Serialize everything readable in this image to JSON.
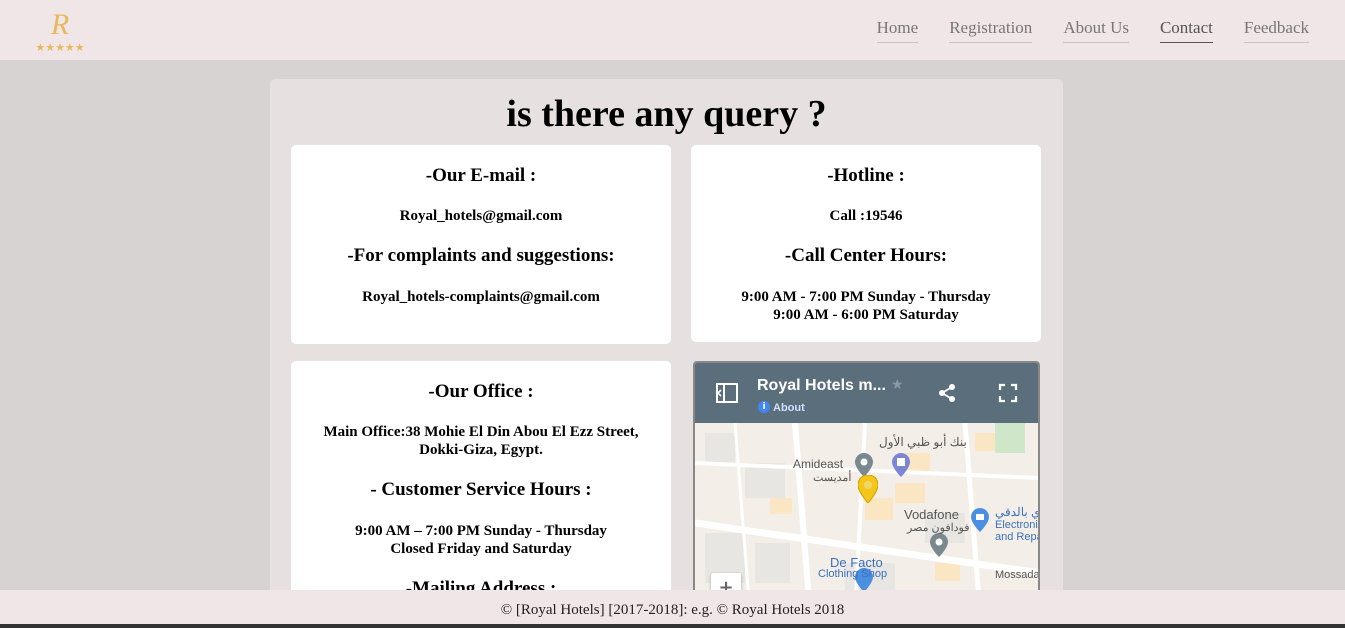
{
  "brand": {
    "logo_letter": "R",
    "logo_stars": "★★★★★"
  },
  "nav": {
    "items": [
      {
        "label": "Home"
      },
      {
        "label": "Registration"
      },
      {
        "label": "About Us"
      },
      {
        "label": "Contact"
      },
      {
        "label": "Feedback"
      }
    ],
    "active": "Contact"
  },
  "page": {
    "title": "is there any query ?"
  },
  "email_card": {
    "heading": "-Our E-mail :",
    "email": "Royal_hotels@gmail.com",
    "complaints_heading": "-For complaints and suggestions:",
    "complaints_email": "Royal_hotels-complaints@gmail.com"
  },
  "hotline_card": {
    "heading": "-Hotline :",
    "call": "Call :19546",
    "hours_heading": "-Call Center Hours:",
    "hours_line1": "9:00 AM - 7:00 PM Sunday - Thursday",
    "hours_line2": "9:00 AM - 6:00 PM Saturday"
  },
  "office_card": {
    "heading": "-Our Office :",
    "address": "Main Office:38 Mohie El Din Abou El Ezz Street, Dokki-Giza, Egypt.",
    "service_heading": "- Customer Service Hours :",
    "service_line1": "9:00 AM – 7:00 PM Sunday - Thursday",
    "service_line2": "Closed Friday and Saturday",
    "mailing_heading": "-Mailing Address :"
  },
  "map": {
    "title": "Royal Hotels m...",
    "about": "About",
    "labels": {
      "amideast": "Amideast",
      "amideast_ar": "أمديست",
      "bank_ar": "بنك أبو ظبي الأول",
      "vodafone": "Vodafone",
      "vodafone_ar": "فودافون مصر",
      "electronic1": "Electronic",
      "electronic2": "and Repai",
      "dokki_ar": "ي بالدقي",
      "defacto": "De Facto",
      "defacto_sub": "Clothing Shop",
      "mossada": "Mossada",
      "zoom_in": "+"
    },
    "colors": {
      "header": "#5b6e7b",
      "pin": "#f5c518"
    }
  },
  "footer": {
    "text": "© [Royal Hotels] [2017-2018]: e.g.  © Royal Hotels 2018"
  }
}
